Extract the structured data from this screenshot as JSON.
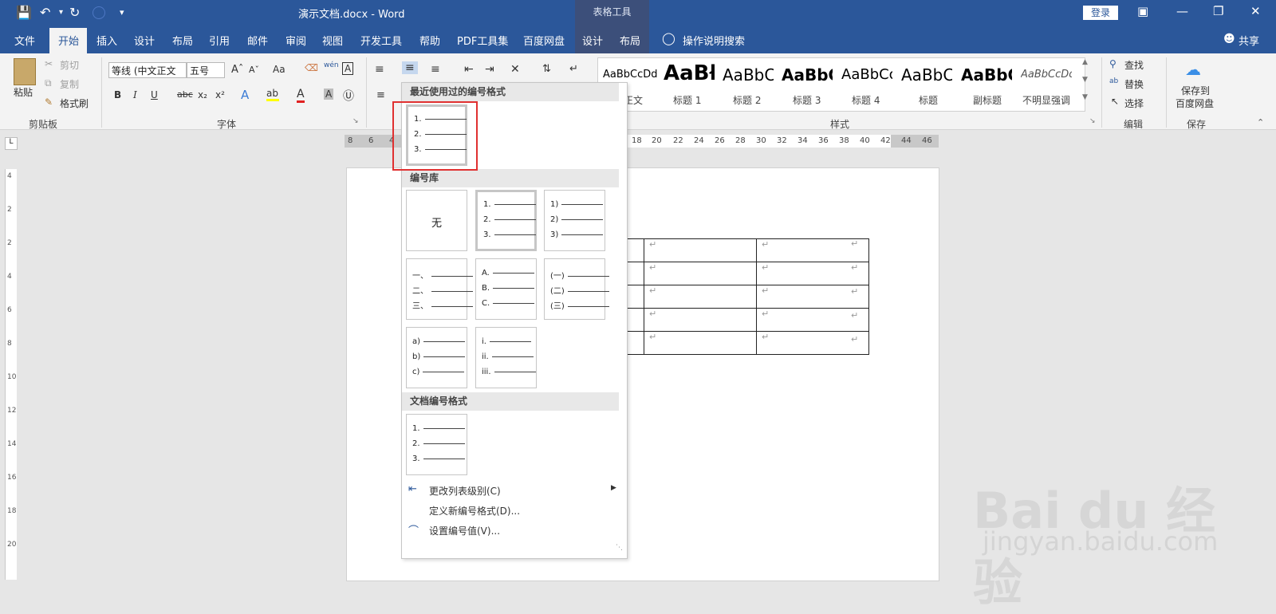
{
  "window": {
    "title": "演示文档.docx  -  Word",
    "contextual_header": "表格工具",
    "login": "登录",
    "qa_icons": [
      "save-icon",
      "undo-icon",
      "redo-icon",
      "autosave-icon",
      "customize-icon"
    ]
  },
  "tabs": [
    "文件",
    "开始",
    "插入",
    "设计",
    "布局",
    "引用",
    "邮件",
    "审阅",
    "视图",
    "开发工具",
    "帮助",
    "PDF工具集",
    "百度网盘",
    "设计",
    "布局"
  ],
  "tell_me": "操作说明搜索",
  "share": "共享",
  "clipboard": {
    "paste": "粘贴",
    "cut": "剪切",
    "copy": "复制",
    "format_painter": "格式刷",
    "label": "剪贴板"
  },
  "font": {
    "name": "等线 (中文正文",
    "size": "五号",
    "label": "字体",
    "aa": "Aa",
    "wen": "wén"
  },
  "styles": {
    "label": "样式",
    "items": [
      {
        "preview": "AaBbCcDd",
        "name": "正文"
      },
      {
        "preview": "AaBł",
        "name": "标题 1"
      },
      {
        "preview": "AaBbC",
        "name": "标题 2"
      },
      {
        "preview": "AaBbC",
        "name": "标题 3"
      },
      {
        "preview": "AaBbCc",
        "name": "标题 4"
      },
      {
        "preview": "AaBbC",
        "name": "标题"
      },
      {
        "preview": "AaBbC",
        "name": "副标题"
      },
      {
        "preview": "AaBbCcDd",
        "name": "不明显强调"
      }
    ]
  },
  "editing": {
    "find": "查找",
    "replace": "替换",
    "select": "选择",
    "label": "编辑"
  },
  "save_group": {
    "button": "保存到\n百度网盘",
    "line1": "保存到",
    "line2": "百度网盘",
    "label": "保存"
  },
  "ruler": [
    "8",
    "6",
    "4",
    "18",
    "20",
    "22",
    "24",
    "26",
    "28",
    "30",
    "32",
    "34",
    "36",
    "38",
    "40",
    "42",
    "44",
    "46"
  ],
  "vruler": [
    "4",
    "2",
    "2",
    "4",
    "6",
    "8",
    "10",
    "12",
    "14",
    "16",
    "18",
    "20"
  ],
  "numbering_menu": {
    "recent_header": "最近使用过的编号格式",
    "library_header": "编号库",
    "document_header": "文档编号格式",
    "none_label": "无",
    "recent": [
      [
        "1.",
        "2.",
        "3."
      ]
    ],
    "library": [
      [
        "1.",
        "2.",
        "3."
      ],
      [
        "1)",
        "2)",
        "3)"
      ],
      [
        "一、",
        "二、",
        "三、"
      ],
      [
        "A.",
        "B.",
        "C."
      ],
      [
        "(一)",
        "(二)",
        "(三)"
      ],
      [
        "a)",
        "b)",
        "c)"
      ],
      [
        "i.",
        "ii.",
        "iii."
      ]
    ],
    "document": [
      [
        "1.",
        "2.",
        "3."
      ]
    ],
    "items": [
      {
        "label": "更改列表级别(C)",
        "has_submenu": true
      },
      {
        "label": "定义新编号格式(D)...",
        "has_submenu": false
      },
      {
        "label": "设置编号值(V)...",
        "has_submenu": false
      }
    ]
  },
  "table": {
    "rows": 5,
    "cell_mark": "↵"
  },
  "watermark": {
    "main": "Bai du 经验",
    "sub": "jingyan.baidu.com"
  },
  "colors": {
    "accent": "#2b579a",
    "highlight": "#e03131"
  }
}
